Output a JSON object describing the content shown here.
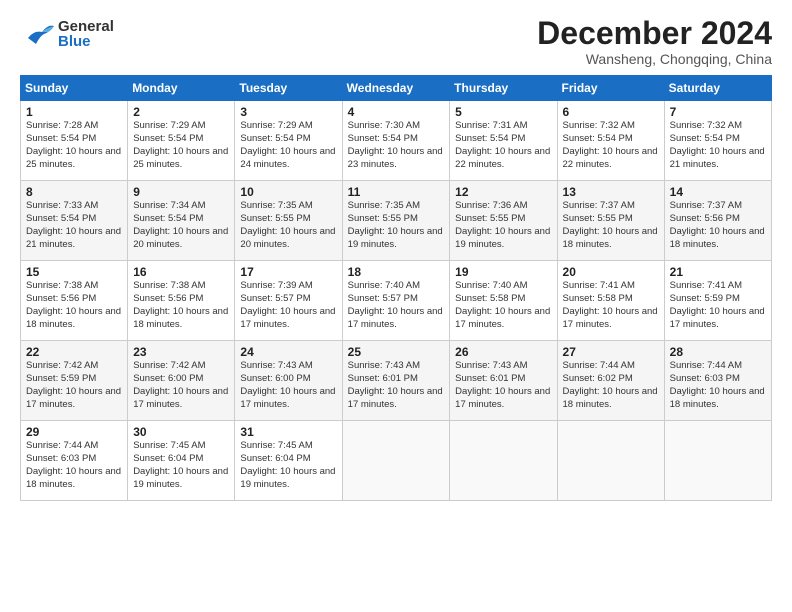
{
  "header": {
    "logo_general": "General",
    "logo_blue": "Blue",
    "title": "December 2024",
    "subtitle": "Wansheng, Chongqing, China"
  },
  "calendar": {
    "days_of_week": [
      "Sunday",
      "Monday",
      "Tuesday",
      "Wednesday",
      "Thursday",
      "Friday",
      "Saturday"
    ],
    "weeks": [
      [
        {
          "date": "1",
          "sunrise": "Sunrise: 7:28 AM",
          "sunset": "Sunset: 5:54 PM",
          "daylight": "Daylight: 10 hours and 25 minutes."
        },
        {
          "date": "2",
          "sunrise": "Sunrise: 7:29 AM",
          "sunset": "Sunset: 5:54 PM",
          "daylight": "Daylight: 10 hours and 25 minutes."
        },
        {
          "date": "3",
          "sunrise": "Sunrise: 7:29 AM",
          "sunset": "Sunset: 5:54 PM",
          "daylight": "Daylight: 10 hours and 24 minutes."
        },
        {
          "date": "4",
          "sunrise": "Sunrise: 7:30 AM",
          "sunset": "Sunset: 5:54 PM",
          "daylight": "Daylight: 10 hours and 23 minutes."
        },
        {
          "date": "5",
          "sunrise": "Sunrise: 7:31 AM",
          "sunset": "Sunset: 5:54 PM",
          "daylight": "Daylight: 10 hours and 22 minutes."
        },
        {
          "date": "6",
          "sunrise": "Sunrise: 7:32 AM",
          "sunset": "Sunset: 5:54 PM",
          "daylight": "Daylight: 10 hours and 22 minutes."
        },
        {
          "date": "7",
          "sunrise": "Sunrise: 7:32 AM",
          "sunset": "Sunset: 5:54 PM",
          "daylight": "Daylight: 10 hours and 21 minutes."
        }
      ],
      [
        {
          "date": "8",
          "sunrise": "Sunrise: 7:33 AM",
          "sunset": "Sunset: 5:54 PM",
          "daylight": "Daylight: 10 hours and 21 minutes."
        },
        {
          "date": "9",
          "sunrise": "Sunrise: 7:34 AM",
          "sunset": "Sunset: 5:54 PM",
          "daylight": "Daylight: 10 hours and 20 minutes."
        },
        {
          "date": "10",
          "sunrise": "Sunrise: 7:35 AM",
          "sunset": "Sunset: 5:55 PM",
          "daylight": "Daylight: 10 hours and 20 minutes."
        },
        {
          "date": "11",
          "sunrise": "Sunrise: 7:35 AM",
          "sunset": "Sunset: 5:55 PM",
          "daylight": "Daylight: 10 hours and 19 minutes."
        },
        {
          "date": "12",
          "sunrise": "Sunrise: 7:36 AM",
          "sunset": "Sunset: 5:55 PM",
          "daylight": "Daylight: 10 hours and 19 minutes."
        },
        {
          "date": "13",
          "sunrise": "Sunrise: 7:37 AM",
          "sunset": "Sunset: 5:55 PM",
          "daylight": "Daylight: 10 hours and 18 minutes."
        },
        {
          "date": "14",
          "sunrise": "Sunrise: 7:37 AM",
          "sunset": "Sunset: 5:56 PM",
          "daylight": "Daylight: 10 hours and 18 minutes."
        }
      ],
      [
        {
          "date": "15",
          "sunrise": "Sunrise: 7:38 AM",
          "sunset": "Sunset: 5:56 PM",
          "daylight": "Daylight: 10 hours and 18 minutes."
        },
        {
          "date": "16",
          "sunrise": "Sunrise: 7:38 AM",
          "sunset": "Sunset: 5:56 PM",
          "daylight": "Daylight: 10 hours and 18 minutes."
        },
        {
          "date": "17",
          "sunrise": "Sunrise: 7:39 AM",
          "sunset": "Sunset: 5:57 PM",
          "daylight": "Daylight: 10 hours and 17 minutes."
        },
        {
          "date": "18",
          "sunrise": "Sunrise: 7:40 AM",
          "sunset": "Sunset: 5:57 PM",
          "daylight": "Daylight: 10 hours and 17 minutes."
        },
        {
          "date": "19",
          "sunrise": "Sunrise: 7:40 AM",
          "sunset": "Sunset: 5:58 PM",
          "daylight": "Daylight: 10 hours and 17 minutes."
        },
        {
          "date": "20",
          "sunrise": "Sunrise: 7:41 AM",
          "sunset": "Sunset: 5:58 PM",
          "daylight": "Daylight: 10 hours and 17 minutes."
        },
        {
          "date": "21",
          "sunrise": "Sunrise: 7:41 AM",
          "sunset": "Sunset: 5:59 PM",
          "daylight": "Daylight: 10 hours and 17 minutes."
        }
      ],
      [
        {
          "date": "22",
          "sunrise": "Sunrise: 7:42 AM",
          "sunset": "Sunset: 5:59 PM",
          "daylight": "Daylight: 10 hours and 17 minutes."
        },
        {
          "date": "23",
          "sunrise": "Sunrise: 7:42 AM",
          "sunset": "Sunset: 6:00 PM",
          "daylight": "Daylight: 10 hours and 17 minutes."
        },
        {
          "date": "24",
          "sunrise": "Sunrise: 7:43 AM",
          "sunset": "Sunset: 6:00 PM",
          "daylight": "Daylight: 10 hours and 17 minutes."
        },
        {
          "date": "25",
          "sunrise": "Sunrise: 7:43 AM",
          "sunset": "Sunset: 6:01 PM",
          "daylight": "Daylight: 10 hours and 17 minutes."
        },
        {
          "date": "26",
          "sunrise": "Sunrise: 7:43 AM",
          "sunset": "Sunset: 6:01 PM",
          "daylight": "Daylight: 10 hours and 17 minutes."
        },
        {
          "date": "27",
          "sunrise": "Sunrise: 7:44 AM",
          "sunset": "Sunset: 6:02 PM",
          "daylight": "Daylight: 10 hours and 18 minutes."
        },
        {
          "date": "28",
          "sunrise": "Sunrise: 7:44 AM",
          "sunset": "Sunset: 6:03 PM",
          "daylight": "Daylight: 10 hours and 18 minutes."
        }
      ],
      [
        {
          "date": "29",
          "sunrise": "Sunrise: 7:44 AM",
          "sunset": "Sunset: 6:03 PM",
          "daylight": "Daylight: 10 hours and 18 minutes."
        },
        {
          "date": "30",
          "sunrise": "Sunrise: 7:45 AM",
          "sunset": "Sunset: 6:04 PM",
          "daylight": "Daylight: 10 hours and 19 minutes."
        },
        {
          "date": "31",
          "sunrise": "Sunrise: 7:45 AM",
          "sunset": "Sunset: 6:04 PM",
          "daylight": "Daylight: 10 hours and 19 minutes."
        },
        null,
        null,
        null,
        null
      ]
    ]
  }
}
